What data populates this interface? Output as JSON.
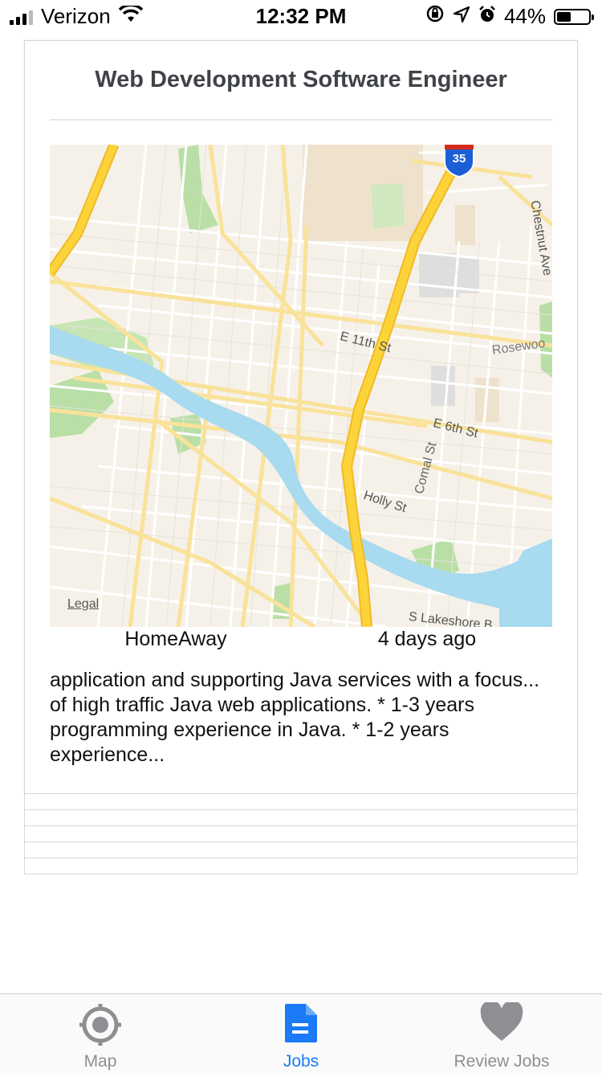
{
  "status_bar": {
    "carrier": "Verizon",
    "time": "12:32 PM",
    "battery_percent": "44%",
    "battery_level": 0.44,
    "icons": [
      "signal-icon",
      "wifi-icon",
      "orientation-lock-icon",
      "location-icon",
      "alarm-icon",
      "battery-icon"
    ]
  },
  "job_card": {
    "title": "Web Development Software Engineer",
    "company": "HomeAway",
    "posted": "4 days ago",
    "description": "application and supporting Java services with a focus... of high traffic Java web applications. * 1-3 years programming experience in Java. * 1-2 years experience...",
    "map": {
      "legal": "Legal",
      "highway_shield": "35",
      "street_labels": [
        "E 11th St",
        "Rosewoo",
        "E 6th St",
        "Comal St",
        "Holly St",
        "S Lakeshore B",
        "Chestnut Ave"
      ],
      "colors": {
        "land": "#f6f1e8",
        "water": "#a8daf0",
        "park": "#b9dfa6",
        "highway": "#fcd43a",
        "arterial": "#f9e29a"
      }
    }
  },
  "tab_bar": {
    "tabs": [
      {
        "label": "Map",
        "icon": "crosshair-icon",
        "active": false
      },
      {
        "label": "Jobs",
        "icon": "document-icon",
        "active": true
      },
      {
        "label": "Review Jobs",
        "icon": "heart-icon",
        "active": false
      }
    ],
    "colors": {
      "active": "#1a7af8",
      "inactive": "#8e8e93"
    }
  }
}
